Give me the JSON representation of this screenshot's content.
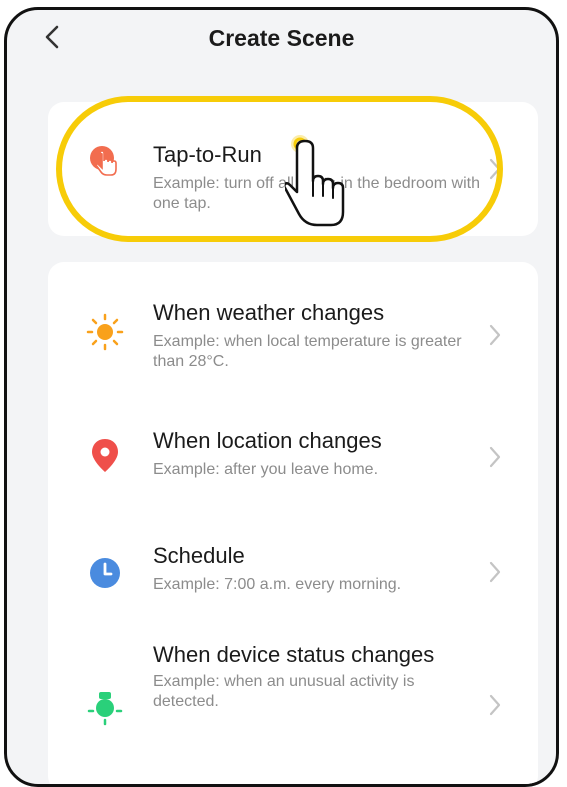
{
  "header": {
    "title": "Create Scene",
    "back_icon": "chevron-left-icon"
  },
  "tap_to_run": {
    "title": "Tap-to-Run",
    "description": "Example: turn off all lights in the bedroom with one tap.",
    "icon": "hand-tap-icon",
    "icon_color": "#f26d4f"
  },
  "conditions": [
    {
      "title": "When weather changes",
      "description": "Example: when local temperature is greater than 28°C.",
      "icon": "sun-icon",
      "icon_color": "#f9a11b"
    },
    {
      "title": "When location changes",
      "description": "Example: after you leave home.",
      "icon": "location-pin-icon",
      "icon_color": "#ef4f4a"
    },
    {
      "title": "Schedule",
      "description": "Example: 7:00 a.m. every morning.",
      "icon": "clock-icon",
      "icon_color": "#4a8bdf"
    },
    {
      "title": "When device status changes",
      "description": "Example: when an unusual activity is detected.",
      "icon": "device-status-icon",
      "icon_color": "#2ad07a"
    }
  ],
  "annotation": {
    "highlight_color": "#f7cc08",
    "pointer_icon": "hand-pointer-icon"
  }
}
